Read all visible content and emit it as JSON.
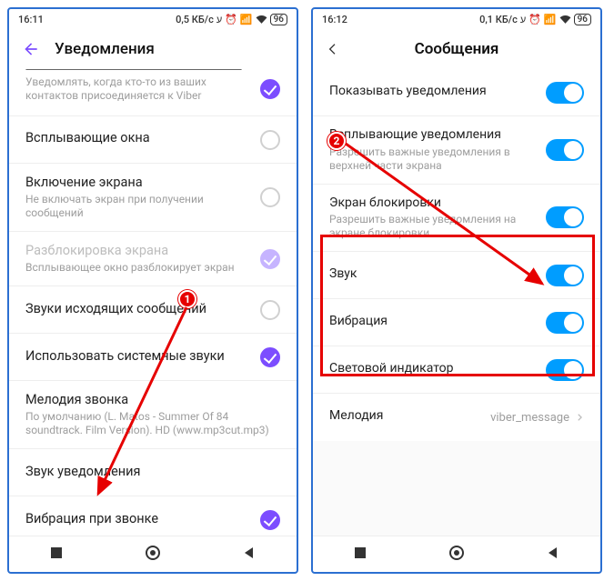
{
  "phone1": {
    "status": {
      "time": "16:11",
      "net": "0,5 КБ/с",
      "battery": "96"
    },
    "title": "Уведомления",
    "rows": [
      {
        "primary": "",
        "secondary": "Уведомлять, когда кто-то из ваших контактов присоединяется к Viber",
        "state": "checked"
      },
      {
        "primary": "Всплывающие окна",
        "state": "empty"
      },
      {
        "primary": "Включение экрана",
        "secondary": "Не включать экран при получении сообщений",
        "state": "empty"
      },
      {
        "primary": "Разблокировка экрана",
        "secondary": "Всплывающее окно разблокирует экран",
        "state": "checked-faded",
        "disabled": true
      },
      {
        "primary": "Звуки исходящих сообщений",
        "state": "empty"
      },
      {
        "primary": "Использовать системные звуки",
        "state": "checked"
      },
      {
        "primary": "Мелодия звонка",
        "secondary": "По умолчанию (L. Matos - Summer Of 84 soundtrack. Film Version). HD (www.mp3cut.mp3)"
      },
      {
        "primary": "Звук уведомления"
      },
      {
        "primary": "Вибрация при звонке",
        "state": "checked"
      }
    ]
  },
  "phone2": {
    "status": {
      "time": "16:12",
      "net": "0,1 КБ/с",
      "battery": "96"
    },
    "title": "Сообщения",
    "rows": [
      {
        "primary": "Показывать уведомления",
        "toggle": true
      },
      {
        "primary": "Всплывающие уведомления",
        "secondary": "Разрешить важные уведомления в верхней части экрана",
        "toggle": true
      },
      {
        "primary": "Экран блокировки",
        "secondary": "Разрешить важные уведомления на экране блокировки",
        "toggle": true
      },
      {
        "primary": "Звук",
        "toggle": true
      },
      {
        "primary": "Вибрация",
        "toggle": true
      },
      {
        "primary": "Световой индикатор",
        "toggle": true
      },
      {
        "primary": "Мелодия",
        "value": "viber_message"
      }
    ]
  },
  "annotations": {
    "c1": "1",
    "c2": "2"
  }
}
